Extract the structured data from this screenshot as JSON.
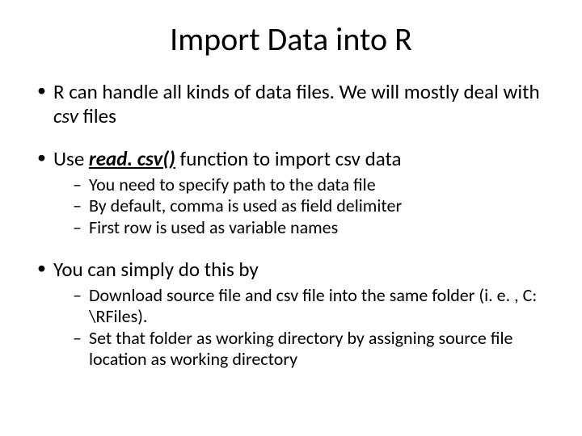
{
  "title": "Import Data into R",
  "b1": {
    "pre": "R can handle all kinds of data files. We will mostly deal with ",
    "csv": "csv",
    "post": " files"
  },
  "b2": {
    "pre": "Use ",
    "fn": "read. csv()",
    "post": " function to import csv data",
    "s1": "You need to specify path to the data file",
    "s2": "By default, comma is used as field delimiter",
    "s3": "First row is used as variable names"
  },
  "b3": {
    "text": "You can simply do this by",
    "s1": "Download source file and csv file into the same folder (i. e. , C: \\RFiles).",
    "s2": "Set that folder as working directory by assigning source file location as working directory"
  }
}
